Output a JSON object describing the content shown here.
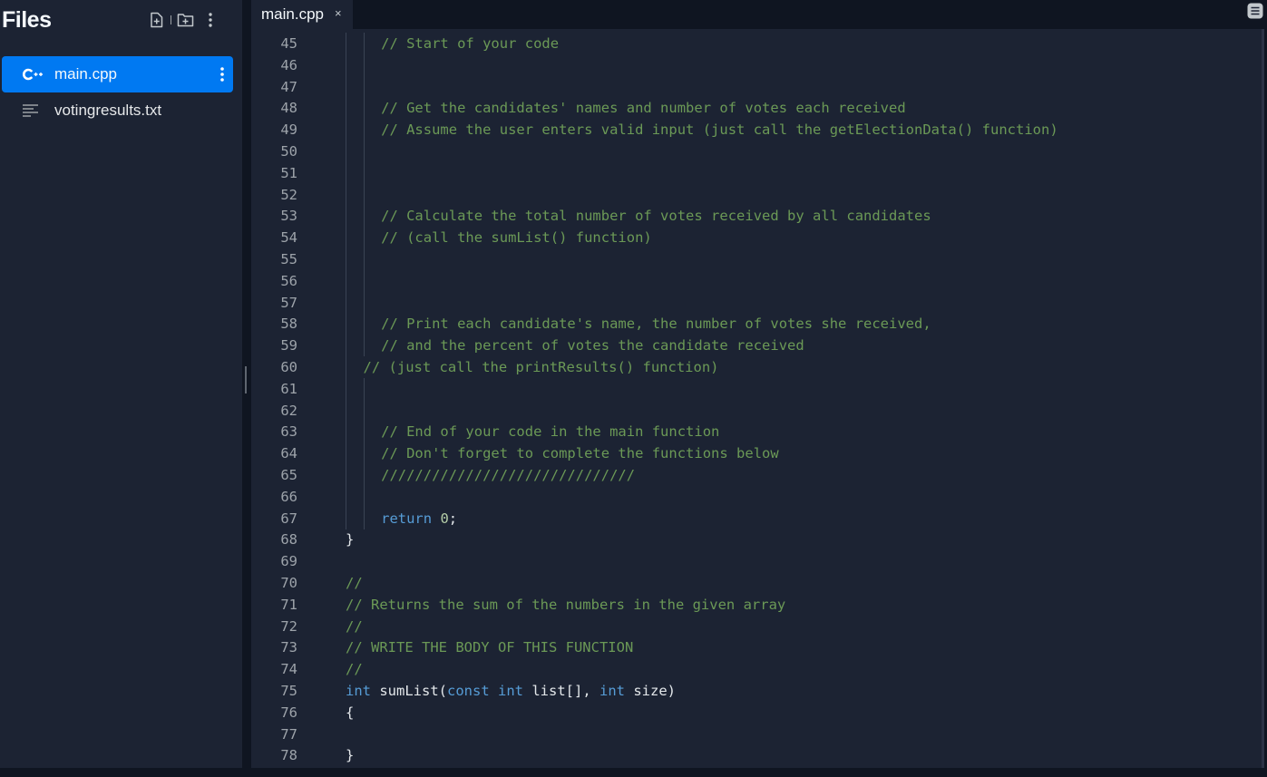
{
  "sidebar": {
    "title": "Files",
    "actions": [
      "new-file",
      "new-folder",
      "more"
    ],
    "files": [
      {
        "name": "main.cpp",
        "icon": "cpp-icon",
        "active": true
      },
      {
        "name": "votingresults.txt",
        "icon": "text-file-icon",
        "active": false
      }
    ]
  },
  "tabs": [
    {
      "label": "main.cpp",
      "close": "×"
    }
  ],
  "editor": {
    "lines": [
      {
        "n": "45",
        "indent": 1,
        "tokens": [
          {
            "t": "// Start of your code",
            "c": "c-com"
          }
        ]
      },
      {
        "n": "46",
        "indent": 1,
        "tokens": []
      },
      {
        "n": "47",
        "indent": 1,
        "tokens": []
      },
      {
        "n": "48",
        "indent": 1,
        "tokens": [
          {
            "t": "// Get the candidates' names and number of votes each received",
            "c": "c-com"
          }
        ]
      },
      {
        "n": "49",
        "indent": 1,
        "tokens": [
          {
            "t": "// Assume the user enters valid input (just call the getElectionData() function)",
            "c": "c-com"
          }
        ]
      },
      {
        "n": "50",
        "indent": 1,
        "tokens": []
      },
      {
        "n": "51",
        "indent": 1,
        "tokens": []
      },
      {
        "n": "52",
        "indent": 1,
        "tokens": []
      },
      {
        "n": "53",
        "indent": 1,
        "tokens": [
          {
            "t": "// Calculate the total number of votes received by all candidates",
            "c": "c-com"
          }
        ]
      },
      {
        "n": "54",
        "indent": 1,
        "tokens": [
          {
            "t": "// (call the sumList() function)",
            "c": "c-com"
          }
        ]
      },
      {
        "n": "55",
        "indent": 1,
        "tokens": []
      },
      {
        "n": "56",
        "indent": 1,
        "tokens": []
      },
      {
        "n": "57",
        "indent": 1,
        "tokens": []
      },
      {
        "n": "58",
        "indent": 1,
        "tokens": [
          {
            "t": "// Print each candidate's name, the number of votes she received,",
            "c": "c-com"
          }
        ]
      },
      {
        "n": "59",
        "indent": 1,
        "tokens": [
          {
            "t": "// and the percent of votes the candidate received",
            "c": "c-com"
          }
        ]
      },
      {
        "n": "60",
        "indent": 0.5,
        "tokens": [
          {
            "t": "// (just call the printResults() function)",
            "c": "c-com"
          }
        ]
      },
      {
        "n": "61",
        "indent": 1,
        "tokens": []
      },
      {
        "n": "62",
        "indent": 1,
        "tokens": []
      },
      {
        "n": "63",
        "indent": 1,
        "tokens": [
          {
            "t": "// End of your code in the main function",
            "c": "c-com"
          }
        ]
      },
      {
        "n": "64",
        "indent": 1,
        "tokens": [
          {
            "t": "// Don't forget to complete the functions below",
            "c": "c-com"
          }
        ]
      },
      {
        "n": "65",
        "indent": 1,
        "tokens": [
          {
            "t": "//////////////////////////////",
            "c": "c-com"
          }
        ]
      },
      {
        "n": "66",
        "indent": 1,
        "tokens": []
      },
      {
        "n": "67",
        "indent": 1,
        "tokens": [
          {
            "t": "return",
            "c": "c-kw"
          },
          {
            "t": " ",
            "c": "c-txt"
          },
          {
            "t": "0",
            "c": "c-num"
          },
          {
            "t": ";",
            "c": "c-txt"
          }
        ]
      },
      {
        "n": "68",
        "indent": 0,
        "tokens": [
          {
            "t": "}",
            "c": "c-txt"
          }
        ]
      },
      {
        "n": "69",
        "indent": 0,
        "tokens": []
      },
      {
        "n": "70",
        "indent": 0,
        "tokens": [
          {
            "t": "//",
            "c": "c-com"
          }
        ]
      },
      {
        "n": "71",
        "indent": 0,
        "tokens": [
          {
            "t": "// Returns the sum of the numbers in the given array",
            "c": "c-com"
          }
        ]
      },
      {
        "n": "72",
        "indent": 0,
        "tokens": [
          {
            "t": "//",
            "c": "c-com"
          }
        ]
      },
      {
        "n": "73",
        "indent": 0,
        "tokens": [
          {
            "t": "// WRITE THE BODY OF THIS FUNCTION",
            "c": "c-com"
          }
        ]
      },
      {
        "n": "74",
        "indent": 0,
        "tokens": [
          {
            "t": "//",
            "c": "c-com"
          }
        ]
      },
      {
        "n": "75",
        "indent": 0,
        "tokens": [
          {
            "t": "int",
            "c": "c-kw"
          },
          {
            "t": " sumList(",
            "c": "c-txt"
          },
          {
            "t": "const",
            "c": "c-kw"
          },
          {
            "t": " ",
            "c": "c-txt"
          },
          {
            "t": "int",
            "c": "c-kw"
          },
          {
            "t": " list[], ",
            "c": "c-txt"
          },
          {
            "t": "int",
            "c": "c-kw"
          },
          {
            "t": " size)",
            "c": "c-txt"
          }
        ]
      },
      {
        "n": "76",
        "indent": 0,
        "tokens": [
          {
            "t": "{",
            "c": "c-txt"
          }
        ]
      },
      {
        "n": "77",
        "indent": 0,
        "tokens": []
      },
      {
        "n": "78",
        "indent": 0,
        "tokens": [
          {
            "t": "}",
            "c": "c-txt"
          }
        ]
      }
    ]
  },
  "colors": {
    "accent": "#0079f2",
    "comment": "#6b9956",
    "keyword": "#569cd6",
    "panel": "#1c2333",
    "background": "#0f1521"
  }
}
